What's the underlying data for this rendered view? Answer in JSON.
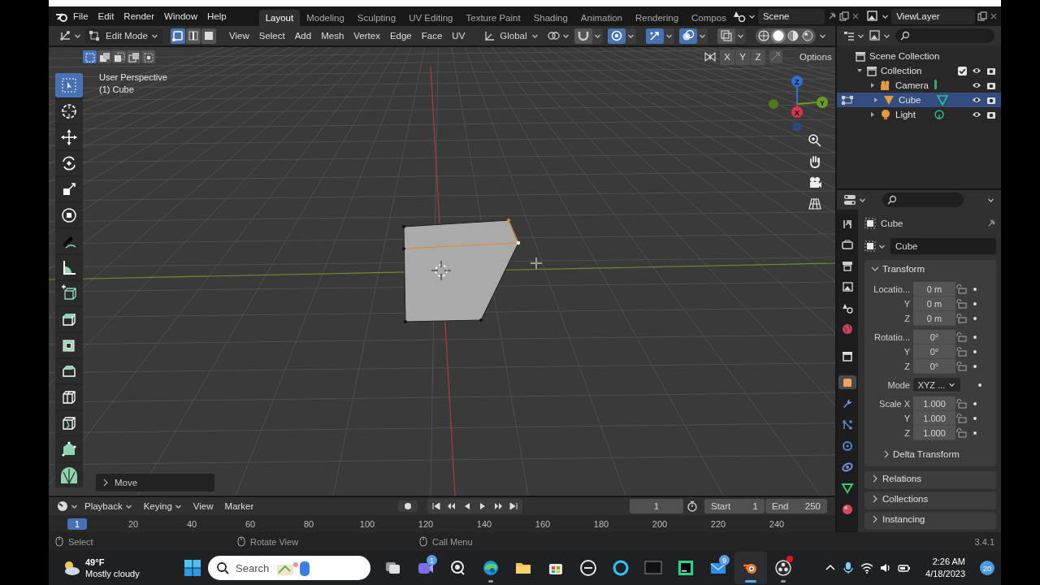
{
  "top_bar": {
    "menus": [
      "File",
      "Edit",
      "Render",
      "Window",
      "Help"
    ],
    "workspaces": [
      {
        "label": "Layout",
        "selected": true
      },
      {
        "label": "Modeling",
        "selected": false
      },
      {
        "label": "Sculpting",
        "selected": false
      },
      {
        "label": "UV Editing",
        "selected": false
      },
      {
        "label": "Texture Paint",
        "selected": false
      },
      {
        "label": "Shading",
        "selected": false
      },
      {
        "label": "Animation",
        "selected": false
      },
      {
        "label": "Rendering",
        "selected": false
      },
      {
        "label": "Compos",
        "selected": false
      }
    ],
    "scene": "Scene",
    "view_layer": "ViewLayer"
  },
  "viewport_header": {
    "mode": "Edit Mode",
    "select_modes": [
      {
        "selected": true
      },
      {
        "selected": false
      },
      {
        "selected": false
      }
    ],
    "menus": [
      "View",
      "Select",
      "Add",
      "Mesh",
      "Vertex",
      "Edge",
      "Face",
      "UV"
    ],
    "orientation": "Global",
    "toggles": [
      {
        "kind": "snap",
        "on": false
      },
      {
        "kind": "proportional",
        "on": true
      },
      {
        "kind": "gizmo",
        "on": true
      },
      {
        "kind": "overlay",
        "on": true
      },
      {
        "kind": "xray",
        "on": false
      }
    ],
    "shading": [
      {
        "selected": false
      },
      {
        "selected": true
      },
      {
        "selected": false
      },
      {
        "selected": false
      }
    ]
  },
  "tool_settings": {
    "box_modes": [
      {
        "selected": true
      },
      {
        "selected": false
      },
      {
        "selected": false
      },
      {
        "selected": false
      },
      {
        "selected": false
      }
    ],
    "mirror_axes": [
      {
        "label": "X",
        "on": false
      },
      {
        "label": "Y",
        "on": false
      },
      {
        "label": "Z",
        "on": false
      }
    ],
    "options": "Options"
  },
  "viewport": {
    "view_name": "User Perspective",
    "object_line": "(1) Cube",
    "tools": [
      {
        "kind": "select",
        "selected": true
      },
      {
        "kind": "cursor",
        "selected": false
      },
      {
        "kind": "move",
        "selected": false
      },
      {
        "kind": "rotate",
        "selected": false
      },
      {
        "kind": "scale",
        "selected": false
      },
      {
        "kind": "transform",
        "selected": false
      },
      {
        "kind": "annotate",
        "selected": false
      },
      {
        "kind": "measure",
        "selected": false
      },
      {
        "kind": "add-cube",
        "selected": false
      },
      {
        "kind": "extrude",
        "selected": false
      },
      {
        "kind": "inset",
        "selected": false
      },
      {
        "kind": "bevel",
        "selected": false
      },
      {
        "kind": "loop-cut",
        "selected": false
      },
      {
        "kind": "knife",
        "selected": false
      },
      {
        "kind": "poly-build",
        "selected": false
      },
      {
        "kind": "spin",
        "selected": false
      }
    ],
    "gizmo_axes": [
      "Z",
      "Y",
      "X"
    ],
    "last_operator": "Move"
  },
  "outliner": {
    "root": "Scene Collection",
    "collections": [
      {
        "label": "Collection",
        "expanded": true,
        "checked": true,
        "children": [
          {
            "label": "Camera",
            "kind": "camera",
            "selected": false
          },
          {
            "label": "Cube",
            "kind": "mesh",
            "selected": true
          },
          {
            "label": "Light",
            "kind": "light",
            "selected": false
          }
        ]
      }
    ]
  },
  "properties": {
    "tabs": [
      {
        "kind": "tool",
        "selected": false
      },
      {
        "kind": "render",
        "selected": false
      },
      {
        "kind": "output",
        "selected": false
      },
      {
        "kind": "view-layer",
        "selected": false
      },
      {
        "kind": "scene",
        "selected": false
      },
      {
        "kind": "world",
        "selected": false
      },
      {
        "kind": "collection",
        "selected": false
      },
      {
        "kind": "object",
        "selected": true
      },
      {
        "kind": "modifier",
        "selected": false
      },
      {
        "kind": "particles",
        "selected": false
      },
      {
        "kind": "physics",
        "selected": false
      },
      {
        "kind": "constraints",
        "selected": false
      },
      {
        "kind": "data",
        "selected": false
      },
      {
        "kind": "material",
        "selected": false
      }
    ],
    "object": "Cube",
    "name_field": "Cube",
    "transform": {
      "title": "Transform",
      "expanded": true,
      "groups": [
        [
          {
            "kind": "field",
            "label": "Locatio...",
            "value": "0 m"
          },
          {
            "kind": "field",
            "label": "Y",
            "value": "0 m"
          },
          {
            "kind": "field",
            "label": "Z",
            "value": "0 m"
          }
        ],
        [
          {
            "kind": "field",
            "label": "Rotatio...",
            "value": "0°"
          },
          {
            "kind": "field",
            "label": "Y",
            "value": "0°"
          },
          {
            "kind": "field",
            "label": "Z",
            "value": "0°"
          }
        ],
        [
          {
            "kind": "dropdown",
            "label": "Mode",
            "value": "XYZ ..."
          }
        ],
        [
          {
            "kind": "field",
            "label": "Scale X",
            "value": "1.000"
          },
          {
            "kind": "field",
            "label": "Y",
            "value": "1.000"
          },
          {
            "kind": "field",
            "label": "Z",
            "value": "1.000"
          }
        ]
      ],
      "subpanel": {
        "title": "Delta Transform",
        "expanded": false
      }
    },
    "panels": [
      {
        "title": "Relations",
        "expanded": false
      },
      {
        "title": "Collections",
        "expanded": false
      },
      {
        "title": "Instancing",
        "expanded": false
      }
    ]
  },
  "timeline": {
    "menus": [
      {
        "label": "Playback",
        "dropdown": true
      },
      {
        "label": "Keying",
        "dropdown": true
      },
      {
        "label": "View",
        "dropdown": false
      },
      {
        "label": "Marker",
        "dropdown": false
      }
    ],
    "current_frame": "1",
    "start_label": "Start",
    "start": "1",
    "end_label": "End",
    "end": "250",
    "ruler_current": "1",
    "ruler_ticks": [
      "20",
      "40",
      "60",
      "80",
      "100",
      "120",
      "140",
      "160",
      "180",
      "200",
      "220",
      "240"
    ]
  },
  "status_bar": {
    "hints": [
      "Select",
      "Rotate View",
      "Call Menu"
    ],
    "version": "3.4.1"
  },
  "taskbar": {
    "temperature": "49°F",
    "weather": "Mostly cloudy",
    "search": "Search",
    "apps": [
      {
        "kind": "task-view",
        "running": false,
        "active": false,
        "alert": false
      },
      {
        "kind": "chat",
        "badge": "1",
        "running": false,
        "active": false,
        "alert": false
      },
      {
        "kind": "camera",
        "running": false,
        "active": false,
        "alert": false
      },
      {
        "kind": "browser",
        "running": true,
        "active": false,
        "alert": false
      },
      {
        "kind": "folder",
        "running": false,
        "active": false,
        "alert": false
      },
      {
        "kind": "store",
        "running": false,
        "active": false,
        "alert": false
      },
      {
        "kind": "dell",
        "running": false,
        "active": false,
        "alert": false
      },
      {
        "kind": "ring",
        "running": false,
        "active": false,
        "alert": false
      },
      {
        "kind": "terminal",
        "running": false,
        "active": false,
        "alert": false
      },
      {
        "kind": "ide",
        "running": false,
        "active": false,
        "alert": false
      },
      {
        "kind": "mail",
        "badge": "9",
        "running": false,
        "active": false,
        "alert": false
      },
      {
        "kind": "blender",
        "running": true,
        "active": true,
        "alert": false
      },
      {
        "kind": "recorder",
        "running": true,
        "active": false,
        "alert": true
      }
    ],
    "time": "2:26 AM",
    "date": "4/18/2023",
    "notifications": "20"
  }
}
